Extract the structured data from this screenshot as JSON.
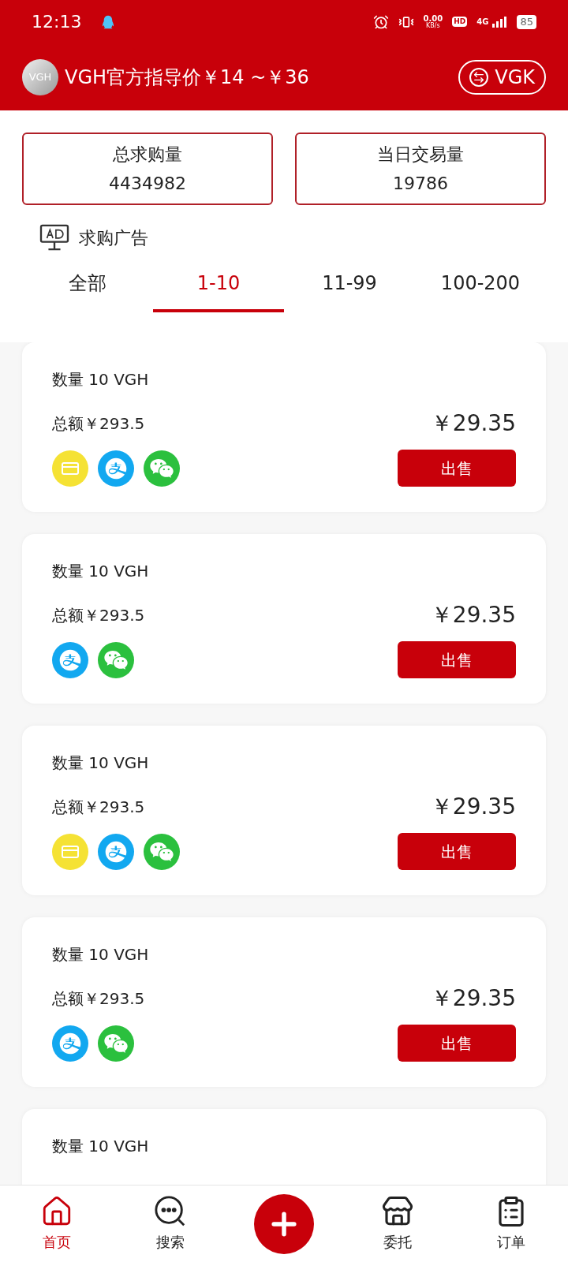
{
  "status_bar": {
    "time": "12:13",
    "speed_value": "0.00",
    "speed_unit": "KB/s",
    "hd": "HD",
    "network": "4G",
    "battery": "85"
  },
  "header": {
    "title": "VGH官方指导价￥14 ~￥36",
    "logo_text": "VGH",
    "switch_label": "VGK"
  },
  "stats": [
    {
      "label": "总求购量",
      "value": "4434982"
    },
    {
      "label": "当日交易量",
      "value": "19786"
    }
  ],
  "section_title": "求购广告",
  "tabs": [
    {
      "label": "全部",
      "selected": false
    },
    {
      "label": "1-10",
      "selected": true
    },
    {
      "label": "11-99",
      "selected": false
    },
    {
      "label": "100-200",
      "selected": false
    }
  ],
  "ads": [
    {
      "quantity": "数量 10 VGH",
      "total": "总额￥293.5",
      "price": "￥29.35",
      "payments": [
        {
          "kind": "card"
        },
        {
          "kind": "alipay"
        },
        {
          "kind": "wechat"
        }
      ],
      "button": "出售"
    },
    {
      "quantity": "数量 10 VGH",
      "total": "总额￥293.5",
      "price": "￥29.35",
      "payments": [
        {
          "kind": "alipay"
        },
        {
          "kind": "wechat"
        }
      ],
      "button": "出售"
    },
    {
      "quantity": "数量 10 VGH",
      "total": "总额￥293.5",
      "price": "￥29.35",
      "payments": [
        {
          "kind": "card"
        },
        {
          "kind": "alipay"
        },
        {
          "kind": "wechat"
        }
      ],
      "button": "出售"
    },
    {
      "quantity": "数量 10 VGH",
      "total": "总额￥293.5",
      "price": "￥29.35",
      "payments": [
        {
          "kind": "alipay"
        },
        {
          "kind": "wechat"
        }
      ],
      "button": "出售"
    },
    {
      "quantity": "数量 10 VGH"
    }
  ],
  "nav": [
    {
      "kind": "home",
      "label": "首页",
      "selected": true
    },
    {
      "kind": "search",
      "label": "搜索",
      "selected": false
    },
    {
      "kind": "add"
    },
    {
      "kind": "store",
      "label": "委托",
      "selected": false
    },
    {
      "kind": "orders",
      "label": "订单",
      "selected": false
    }
  ]
}
